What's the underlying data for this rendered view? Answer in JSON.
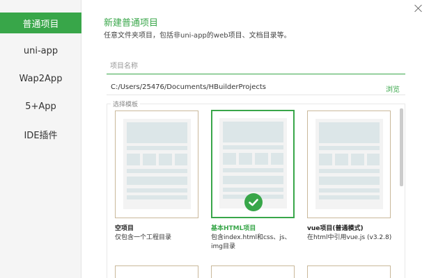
{
  "sidebar": {
    "items": [
      {
        "label": "普通项目",
        "active": true
      },
      {
        "label": "uni-app",
        "active": false
      },
      {
        "label": "Wap2App",
        "active": false
      },
      {
        "label": "5+App",
        "active": false
      },
      {
        "label": "IDE插件",
        "active": false
      }
    ]
  },
  "header": {
    "title": "新建普通项目",
    "subtitle": "任意文件夹项目，包括非uni-app的web项目、文档目录等。"
  },
  "form": {
    "name_placeholder": "项目名称",
    "name_value": "",
    "path": "C:/Users/25476/Documents/HBuilderProjects",
    "browse_label": "浏览"
  },
  "templates": {
    "group_label": "选择模板",
    "cards": [
      {
        "title": "空项目",
        "desc": "仅包含一个工程目录",
        "selected": false
      },
      {
        "title": "基本HTML项目",
        "desc": "包含index.html和css、js、img目录",
        "selected": true
      },
      {
        "title": "vue项目(普通模式)",
        "desc": "在html中引用vue.js (v3.2.8)",
        "selected": false
      }
    ]
  },
  "colors": {
    "accent": "#38a649",
    "card_border": "#c9b89a",
    "thumb_block": "#dce6e8"
  }
}
